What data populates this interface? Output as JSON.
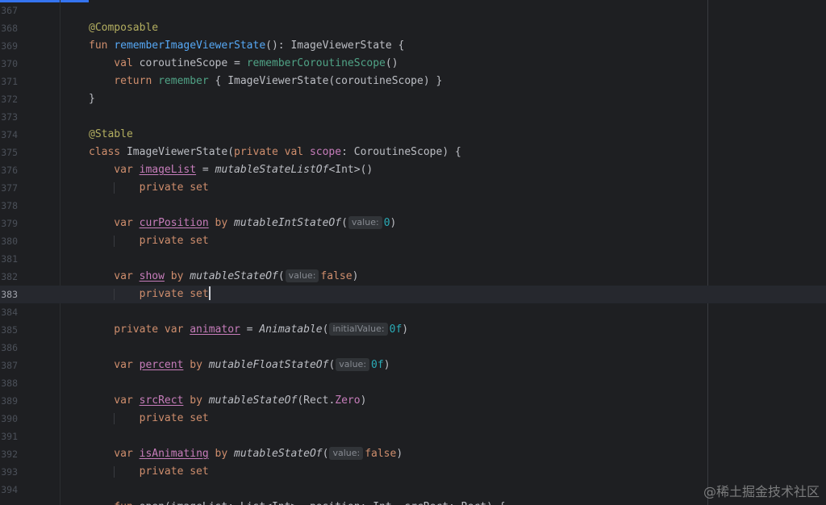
{
  "editor": {
    "current_line": 383,
    "lines": [
      {
        "num": "367",
        "tokens": []
      },
      {
        "num": "368",
        "tokens": [
          {
            "t": "@Composable",
            "c": "ann"
          }
        ]
      },
      {
        "num": "369",
        "tokens": [
          {
            "t": "fun ",
            "c": "kw"
          },
          {
            "t": "rememberImageViewerState",
            "c": "fn"
          },
          {
            "t": "(): ImageViewerState {",
            "c": "plain"
          }
        ]
      },
      {
        "num": "370",
        "tokens": [
          {
            "t": "    val ",
            "c": "kw"
          },
          {
            "t": "coroutineScope = ",
            "c": "plain"
          },
          {
            "t": "rememberCoroutineScope",
            "c": "fn2"
          },
          {
            "t": "()",
            "c": "plain"
          }
        ]
      },
      {
        "num": "371",
        "tokens": [
          {
            "t": "    return ",
            "c": "kw"
          },
          {
            "t": "remember",
            "c": "fn2"
          },
          {
            "t": " { ImageViewerState(coroutineScope) }",
            "c": "plain"
          }
        ]
      },
      {
        "num": "372",
        "tokens": [
          {
            "t": "}",
            "c": "plain"
          }
        ]
      },
      {
        "num": "373",
        "tokens": []
      },
      {
        "num": "374",
        "tokens": [
          {
            "t": "@Stable",
            "c": "ann"
          }
        ]
      },
      {
        "num": "375",
        "tokens": [
          {
            "t": "class ",
            "c": "kw"
          },
          {
            "t": "ImageViewerState(",
            "c": "plain"
          },
          {
            "t": "private val ",
            "c": "kw"
          },
          {
            "t": "scope",
            "c": "enum"
          },
          {
            "t": ": CoroutineScope) {",
            "c": "plain"
          }
        ]
      },
      {
        "num": "376",
        "tokens": [
          {
            "t": "    var ",
            "c": "kw"
          },
          {
            "t": "imageList",
            "c": "prop"
          },
          {
            "t": " = ",
            "c": "plain"
          },
          {
            "t": "mutableStateListOf",
            "c": "ital"
          },
          {
            "t": "<Int>()",
            "c": "plain"
          }
        ]
      },
      {
        "num": "377",
        "guide": true,
        "tokens": [
          {
            "t": "        private set",
            "c": "kw"
          }
        ]
      },
      {
        "num": "378",
        "tokens": []
      },
      {
        "num": "379",
        "tokens": [
          {
            "t": "    var ",
            "c": "kw"
          },
          {
            "t": "curPosition",
            "c": "prop"
          },
          {
            "t": " by ",
            "c": "kw"
          },
          {
            "t": "mutableIntStateOf",
            "c": "ital"
          },
          {
            "t": "(",
            "c": "plain"
          },
          {
            "t": "value:",
            "c": "hint"
          },
          {
            "t": "0",
            "c": "num"
          },
          {
            "t": ")",
            "c": "plain"
          }
        ]
      },
      {
        "num": "380",
        "guide": true,
        "tokens": [
          {
            "t": "        private set",
            "c": "kw"
          }
        ]
      },
      {
        "num": "381",
        "tokens": []
      },
      {
        "num": "382",
        "tokens": [
          {
            "t": "    var ",
            "c": "kw"
          },
          {
            "t": "show",
            "c": "prop"
          },
          {
            "t": " by ",
            "c": "kw"
          },
          {
            "t": "mutableStateOf",
            "c": "ital"
          },
          {
            "t": "(",
            "c": "plain"
          },
          {
            "t": "value:",
            "c": "hint"
          },
          {
            "t": "false",
            "c": "kw"
          },
          {
            "t": ")",
            "c": "plain"
          }
        ]
      },
      {
        "num": "383",
        "guide": true,
        "caret": true,
        "tokens": [
          {
            "t": "        private set",
            "c": "kw"
          }
        ]
      },
      {
        "num": "384",
        "tokens": []
      },
      {
        "num": "385",
        "tokens": [
          {
            "t": "    private var ",
            "c": "kw"
          },
          {
            "t": "animator",
            "c": "prop"
          },
          {
            "t": " = ",
            "c": "plain"
          },
          {
            "t": "Animatable",
            "c": "ital"
          },
          {
            "t": "(",
            "c": "plain"
          },
          {
            "t": "initialValue:",
            "c": "hint"
          },
          {
            "t": "0f",
            "c": "num"
          },
          {
            "t": ")",
            "c": "plain"
          }
        ]
      },
      {
        "num": "386",
        "tokens": []
      },
      {
        "num": "387",
        "tokens": [
          {
            "t": "    var ",
            "c": "kw"
          },
          {
            "t": "percent",
            "c": "prop"
          },
          {
            "t": " by ",
            "c": "kw"
          },
          {
            "t": "mutableFloatStateOf",
            "c": "ital"
          },
          {
            "t": "(",
            "c": "plain"
          },
          {
            "t": "value:",
            "c": "hint"
          },
          {
            "t": "0f",
            "c": "num"
          },
          {
            "t": ")",
            "c": "plain"
          }
        ]
      },
      {
        "num": "388",
        "tokens": []
      },
      {
        "num": "389",
        "tokens": [
          {
            "t": "    var ",
            "c": "kw"
          },
          {
            "t": "srcRect",
            "c": "prop"
          },
          {
            "t": " by ",
            "c": "kw"
          },
          {
            "t": "mutableStateOf",
            "c": "ital"
          },
          {
            "t": "(Rect.",
            "c": "plain"
          },
          {
            "t": "Zero",
            "c": "enum"
          },
          {
            "t": ")",
            "c": "plain"
          }
        ]
      },
      {
        "num": "390",
        "guide": true,
        "tokens": [
          {
            "t": "        private set",
            "c": "kw"
          }
        ]
      },
      {
        "num": "391",
        "tokens": []
      },
      {
        "num": "392",
        "tokens": [
          {
            "t": "    var ",
            "c": "kw"
          },
          {
            "t": "isAnimating",
            "c": "prop"
          },
          {
            "t": " by ",
            "c": "kw"
          },
          {
            "t": "mutableStateOf",
            "c": "ital"
          },
          {
            "t": "(",
            "c": "plain"
          },
          {
            "t": "value:",
            "c": "hint"
          },
          {
            "t": "false",
            "c": "kw"
          },
          {
            "t": ")",
            "c": "plain"
          }
        ]
      },
      {
        "num": "393",
        "guide": true,
        "tokens": [
          {
            "t": "        private set",
            "c": "kw"
          }
        ]
      },
      {
        "num": "394",
        "tokens": []
      },
      {
        "num": "",
        "tokens": [
          {
            "t": "    fun ",
            "c": "kw"
          },
          {
            "t": "open(imageList: List<Int>, position: Int, srcRect: Rect) {",
            "c": "plain"
          }
        ]
      }
    ]
  },
  "watermark": "@稀土掘金技术社区"
}
